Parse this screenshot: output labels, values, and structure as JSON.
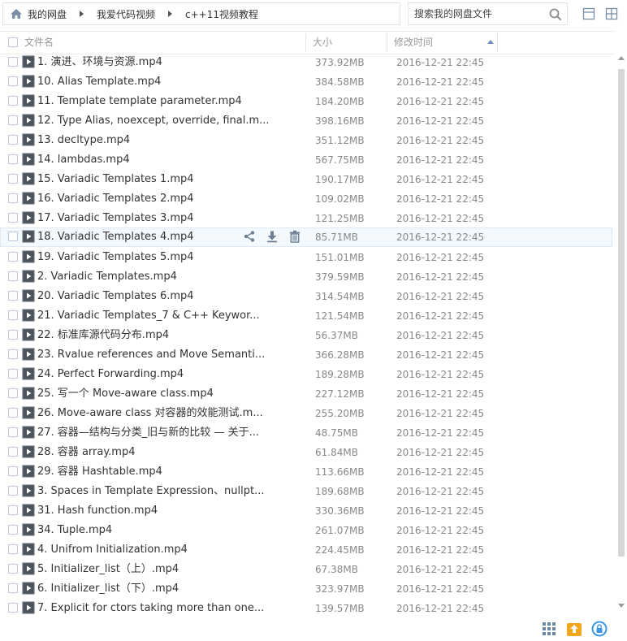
{
  "breadcrumb": [
    "我的网盘",
    "我爱代码视频",
    "c++11视频教程"
  ],
  "search": {
    "placeholder": "搜索我的网盘文件"
  },
  "header": {
    "name": "文件名",
    "size": "大小",
    "modified": "修改时间"
  },
  "files": [
    {
      "name": "1. 演进、环境与资源.mp4",
      "size": "373.92MB",
      "date": "2016-12-21 22:45"
    },
    {
      "name": "10. Alias Template.mp4",
      "size": "384.58MB",
      "date": "2016-12-21 22:45"
    },
    {
      "name": "11. Template template parameter.mp4",
      "size": "184.20MB",
      "date": "2016-12-21 22:45"
    },
    {
      "name": "12. Type Alias, noexcept, override, final.m...",
      "size": "398.16MB",
      "date": "2016-12-21 22:45"
    },
    {
      "name": "13. decltype.mp4",
      "size": "351.12MB",
      "date": "2016-12-21 22:45"
    },
    {
      "name": "14. lambdas.mp4",
      "size": "567.75MB",
      "date": "2016-12-21 22:45"
    },
    {
      "name": "15. Variadic Templates 1.mp4",
      "size": "190.17MB",
      "date": "2016-12-21 22:45"
    },
    {
      "name": "16. Variadic Templates 2.mp4",
      "size": "109.02MB",
      "date": "2016-12-21 22:45"
    },
    {
      "name": "17. Variadic Templates 3.mp4",
      "size": "121.25MB",
      "date": "2016-12-21 22:45"
    },
    {
      "name": "18. Variadic Templates 4.mp4",
      "size": "85.71MB",
      "date": "2016-12-21 22:45"
    },
    {
      "name": "19. Variadic Templates 5.mp4",
      "size": "151.01MB",
      "date": "2016-12-21 22:45"
    },
    {
      "name": "2. Variadic Templates.mp4",
      "size": "379.59MB",
      "date": "2016-12-21 22:45"
    },
    {
      "name": "20. Variadic Templates 6.mp4",
      "size": "314.54MB",
      "date": "2016-12-21 22:45"
    },
    {
      "name": "21. Variadic Templates_7 & C++ Keywor...",
      "size": "121.54MB",
      "date": "2016-12-21 22:45"
    },
    {
      "name": "22. 标准库源代码分布.mp4",
      "size": "56.37MB",
      "date": "2016-12-21 22:45"
    },
    {
      "name": "23. Rvalue references and Move Semanti...",
      "size": "366.28MB",
      "date": "2016-12-21 22:45"
    },
    {
      "name": "24. Perfect Forwarding.mp4",
      "size": "189.28MB",
      "date": "2016-12-21 22:45"
    },
    {
      "name": "25. 写一个 Move-aware class.mp4",
      "size": "227.12MB",
      "date": "2016-12-21 22:45"
    },
    {
      "name": "26. Move-aware class 对容器的效能测试.m...",
      "size": "255.20MB",
      "date": "2016-12-21 22:45"
    },
    {
      "name": "27. 容器—结构与分类_旧与新的比较 — 关于...",
      "size": "48.75MB",
      "date": "2016-12-21 22:45"
    },
    {
      "name": "28. 容器 array.mp4",
      "size": "61.84MB",
      "date": "2016-12-21 22:45"
    },
    {
      "name": "29. 容器 Hashtable.mp4",
      "size": "113.66MB",
      "date": "2016-12-21 22:45"
    },
    {
      "name": "3. Spaces in Template Expression、nullpt...",
      "size": "189.68MB",
      "date": "2016-12-21 22:45"
    },
    {
      "name": "31. Hash function.mp4",
      "size": "330.36MB",
      "date": "2016-12-21 22:45"
    },
    {
      "name": "34. Tuple.mp4",
      "size": "261.07MB",
      "date": "2016-12-21 22:45"
    },
    {
      "name": "4. Unifrom Initialization.mp4",
      "size": "224.45MB",
      "date": "2016-12-21 22:45"
    },
    {
      "name": "5. Initializer_list（上）.mp4",
      "size": "67.38MB",
      "date": "2016-12-21 22:45"
    },
    {
      "name": "6. Initializer_list（下）.mp4",
      "size": "323.97MB",
      "date": "2016-12-21 22:45"
    },
    {
      "name": "7. Explicit for ctors taking more than one...",
      "size": "139.57MB",
      "date": "2016-12-21 22:45"
    }
  ],
  "hovered_row": 9,
  "colors": {
    "accent": "#3b7ec8",
    "icon": "#5a5a5a",
    "hover_bg": "#f4f9fe"
  },
  "icons": {
    "home": "home-icon",
    "search": "search-icon",
    "list_view": "list-view-icon",
    "grid_view": "grid-view-icon",
    "video": "video-file-icon",
    "share": "share-icon",
    "download": "download-icon",
    "delete": "trash-icon",
    "grid_app": "app-grid-icon",
    "upload": "upload-icon",
    "lock": "lock-icon"
  }
}
